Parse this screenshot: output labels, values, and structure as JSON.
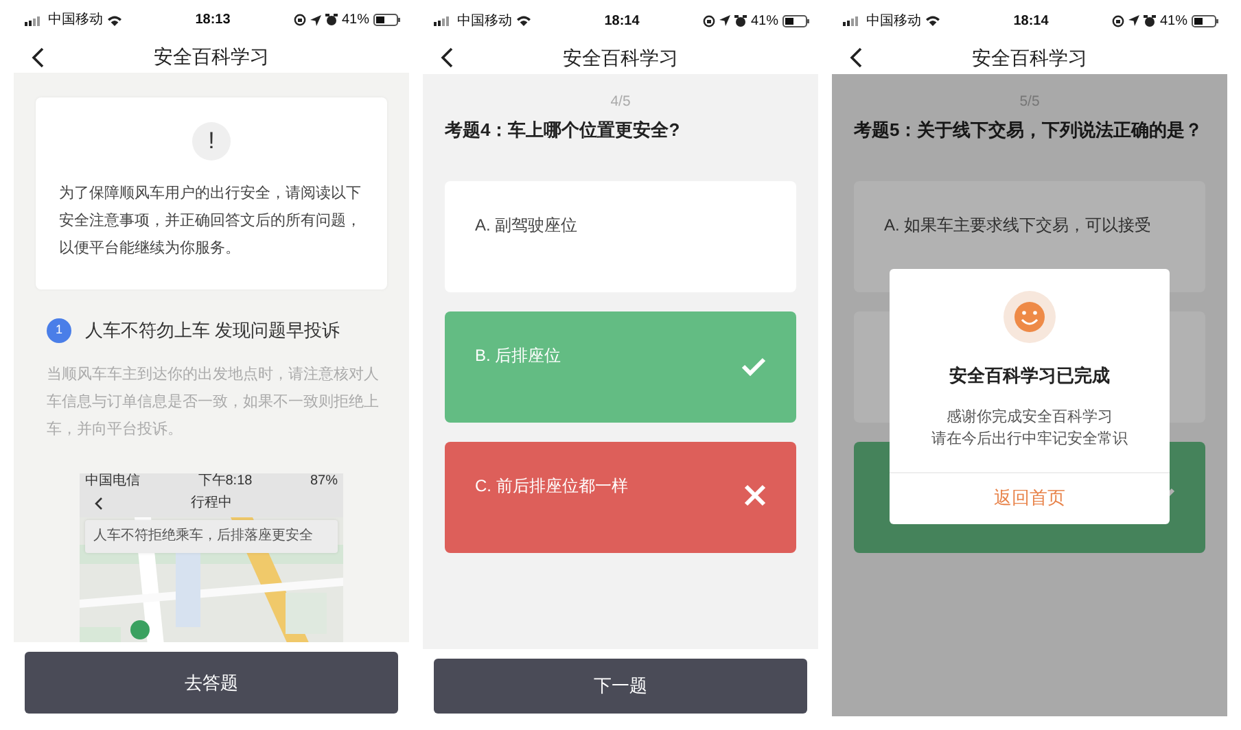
{
  "screens": [
    {
      "kind": "intro",
      "status_bar": {
        "carrier": "中国移动",
        "time": "18:13",
        "battery": "41%"
      },
      "title": "安全百科学习",
      "notice": {
        "icon": "!",
        "text": "为了保障顺风车用户的出行安全，请阅读以下安全注意事项，并正确回答文后的所有问题，以便平台能继续为你服务。"
      },
      "tip": {
        "number": "1",
        "heading": "人车不符勿上车 发现问题早投诉",
        "body": "当顺风车车主到达你的出发地点时，请注意核对人车信息与订单信息是否一致，如果不一致则拒绝上车，并向平台投诉。"
      },
      "example_screenshot": {
        "carrier": "中国电信",
        "time": "下午8:18",
        "battery": "87%",
        "title": "行程中",
        "banner": "人车不符拒绝乘车，后排落座更安全"
      },
      "button": "去答题"
    },
    {
      "kind": "quiz",
      "status_bar": {
        "carrier": "中国移动",
        "time": "18:14",
        "battery": "41%"
      },
      "title": "安全百科学习",
      "progress": "4/5",
      "question": "考题4：车上哪个位置更安全?",
      "options": [
        {
          "label": "A. 副驾驶座位",
          "correct": false,
          "wrong": false
        },
        {
          "label": "B. 后排座位",
          "correct": true,
          "wrong": false
        },
        {
          "label": "C. 前后排座位都一样",
          "correct": false,
          "wrong": true
        }
      ],
      "button": "下一题"
    },
    {
      "kind": "quiz",
      "status_bar": {
        "carrier": "中国移动",
        "time": "18:14",
        "battery": "41%"
      },
      "title": "安全百科学习",
      "progress": "5/5",
      "question": "考题5：关于线下交易，下列说法正确的是？",
      "options": [
        {
          "label": "A. 如果车主要求线下交易，可以接受",
          "correct": false,
          "wrong": false
        },
        {
          "correct": false,
          "wrong": false
        },
        {
          "correct": true,
          "wrong": false
        }
      ],
      "dialog": {
        "title": "安全百科学习已完成",
        "lines": [
          "感谢你完成安全百科学习",
          "请在今后出行中牢记安全常识"
        ],
        "action": "返回首页"
      }
    }
  ]
}
